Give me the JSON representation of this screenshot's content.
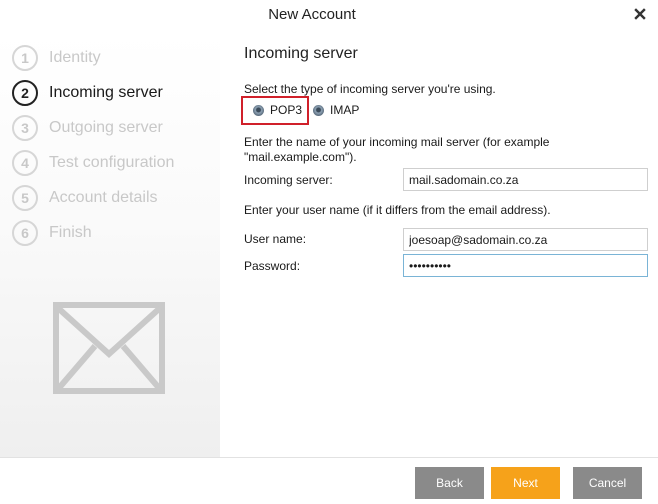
{
  "window": {
    "title": "New Account"
  },
  "steps": [
    {
      "num": "1",
      "label": "Identity"
    },
    {
      "num": "2",
      "label": "Incoming server"
    },
    {
      "num": "3",
      "label": "Outgoing server"
    },
    {
      "num": "4",
      "label": "Test configuration"
    },
    {
      "num": "5",
      "label": "Account details"
    },
    {
      "num": "6",
      "label": "Finish"
    }
  ],
  "active_step": "2",
  "main": {
    "heading": "Incoming server",
    "server_type_prompt": "Select the type of incoming server you're using.",
    "server_types": {
      "pop3": "POP3",
      "imap": "IMAP",
      "selected": "POP3"
    },
    "server_prompt_line1": "Enter the name of your incoming mail server (for example",
    "server_prompt_line2": "\"mail.example.com\").",
    "incoming_server_label": "Incoming server:",
    "incoming_server_value": "mail.sadomain.co.za",
    "username_prompt": "Enter your user name (if it differs from the email address).",
    "username_label": "User name:",
    "username_value": "joesoap@sadomain.co.za",
    "password_label": "Password:",
    "password_value": "••••••••••"
  },
  "buttons": {
    "back": "Back",
    "next": "Next",
    "cancel": "Cancel"
  },
  "colors": {
    "accent": "#f6a21a",
    "neutral_button": "#8a8a8a",
    "highlight_box": "#d0202a"
  },
  "icons": {
    "close": "close-icon",
    "envelope": "envelope-icon",
    "radio": "radio-selected-icon"
  }
}
